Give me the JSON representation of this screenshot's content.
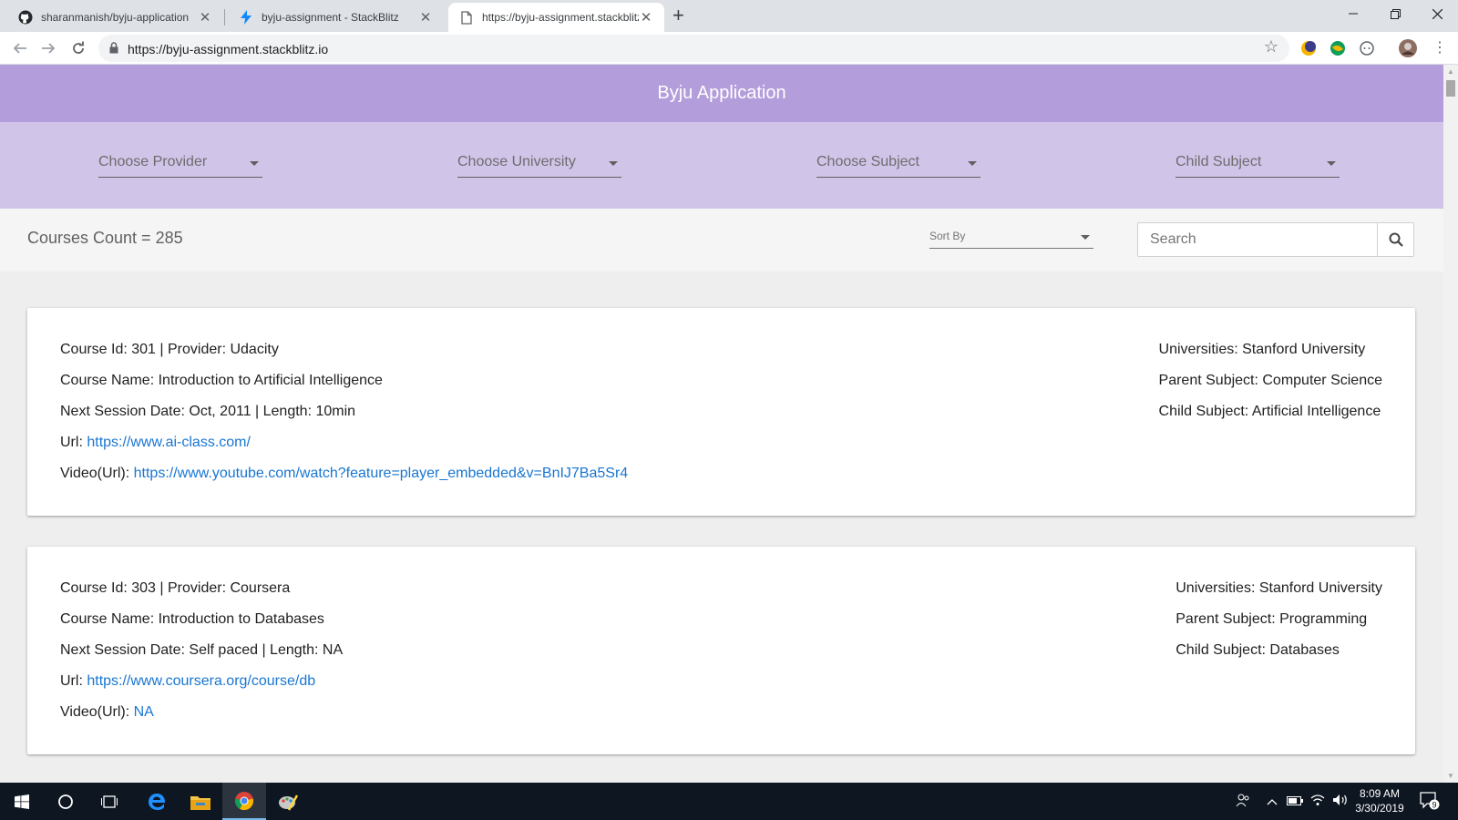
{
  "browser": {
    "tabs": [
      {
        "title": "sharanmanish/byju-application",
        "favicon": "github-icon"
      },
      {
        "title": "byju-assignment - StackBlitz",
        "favicon": "stackblitz-bolt-icon"
      },
      {
        "title": "https://byju-assignment.stackblitz.io",
        "favicon": "page-icon"
      }
    ],
    "new_tab": "+",
    "url": "https://byju-assignment.stackblitz.io"
  },
  "app": {
    "title": "Byju Application",
    "filters": {
      "provider": "Choose Provider",
      "university": "Choose University",
      "subject": "Choose Subject",
      "child_subject": "Child Subject"
    },
    "courses_count": "Courses Count = 285",
    "sort_by": "Sort By",
    "search_placeholder": "Search",
    "courses": [
      {
        "id_provider": "Course Id: 301 | Provider: Udacity",
        "name": "Course Name: Introduction to Artificial Intelligence",
        "session": "Next Session Date: Oct, 2011 | Length: 10min",
        "url_label": "Url:",
        "url": "https://www.ai-class.com/",
        "video_label": "Video(Url):",
        "video": "https://www.youtube.com/watch?feature=player_embedded&v=BnIJ7Ba5Sr4",
        "universities": "Universities: Stanford University",
        "parent_subject": "Parent Subject: Computer Science",
        "child_subject": "Child Subject: Artificial Intelligence"
      },
      {
        "id_provider": "Course Id: 303 | Provider: Coursera",
        "name": "Course Name: Introduction to Databases",
        "session": "Next Session Date: Self paced | Length: NA",
        "url_label": "Url:",
        "url": "https://www.coursera.org/course/db",
        "video_label": "Video(Url):",
        "video": "NA",
        "universities": "Universities: Stanford University",
        "parent_subject": "Parent Subject: Programming",
        "child_subject": "Child Subject: Databases"
      }
    ]
  },
  "taskbar": {
    "time": "8:09 AM",
    "date": "3/30/2019",
    "notification_count": "9"
  },
  "colors": {
    "app_bar": "#b39ddb",
    "filter_bar": "#d1c4e9",
    "link": "#1976d2"
  }
}
